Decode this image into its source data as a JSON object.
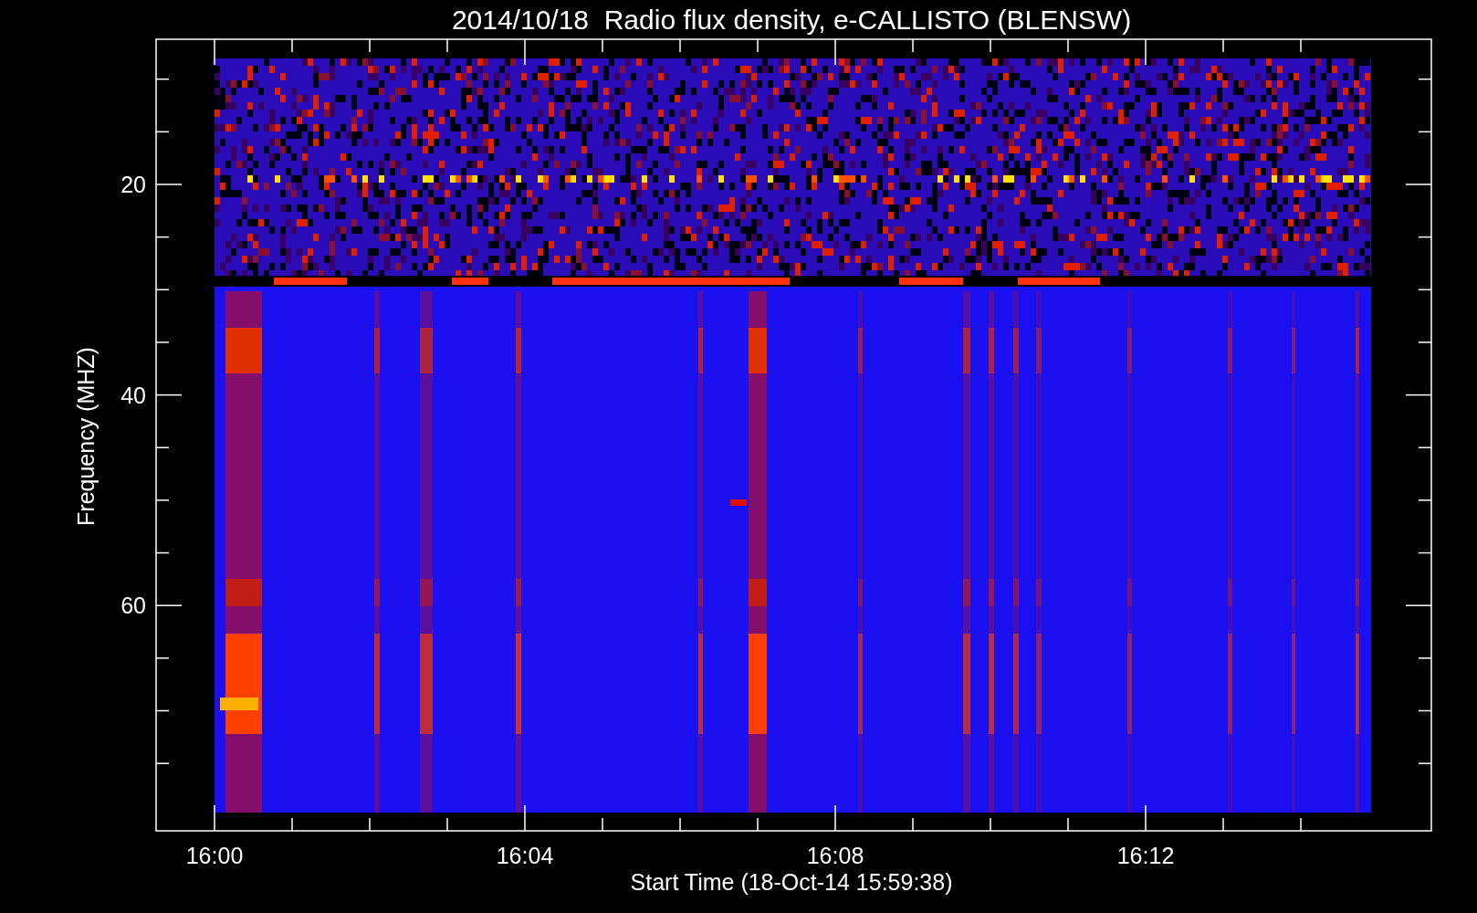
{
  "title": "2014/10/18  Radio flux density, e-CALLISTO (BLENSW)",
  "ylabel": "Frequency (MHZ)",
  "xlabel": "Start Time (18-Oct-14 15:59:38)",
  "yticks": [
    "20",
    "40",
    "60"
  ],
  "xticks": [
    "16:00",
    "16:04",
    "16:08",
    "16:12"
  ],
  "spectrogram": {
    "kind": "picture"
  }
}
